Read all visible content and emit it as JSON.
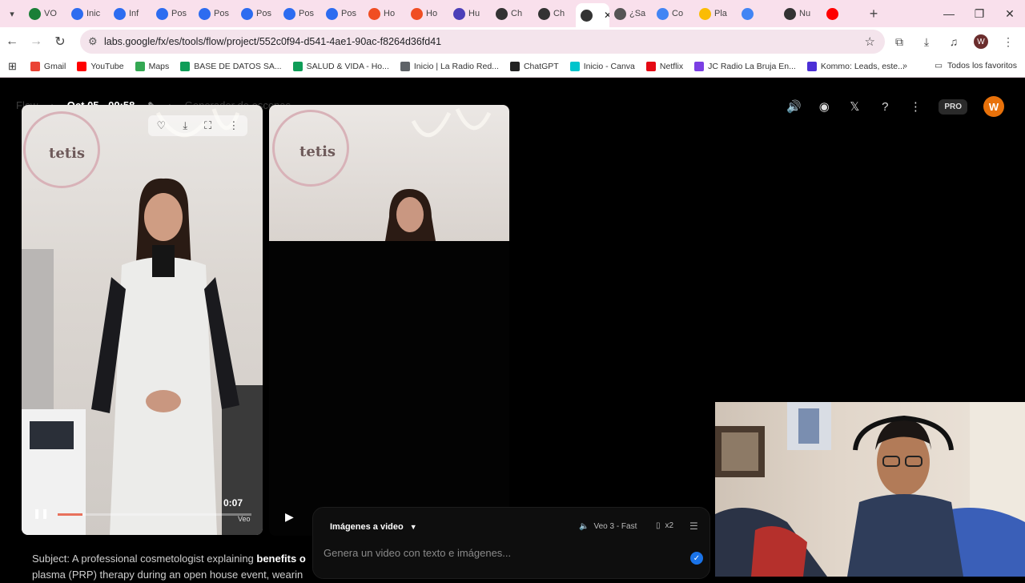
{
  "browser": {
    "tabs": [
      {
        "label": "VO",
        "icon": "github-icon",
        "color": "#1a7f37"
      },
      {
        "label": "Inic",
        "icon": "zoom-icon",
        "color": "#2d6cf0"
      },
      {
        "label": "Inf",
        "icon": "zoom-icon",
        "color": "#2d6cf0"
      },
      {
        "label": "Pos",
        "icon": "zoom-icon",
        "color": "#2d6cf0"
      },
      {
        "label": "Pos",
        "icon": "zoom-icon",
        "color": "#2d6cf0"
      },
      {
        "label": "Pos",
        "icon": "zoom-icon",
        "color": "#2d6cf0"
      },
      {
        "label": "Pos",
        "icon": "zoom-icon",
        "color": "#2d6cf0"
      },
      {
        "label": "Pos",
        "icon": "zoom-icon",
        "color": "#2d6cf0"
      },
      {
        "label": "Ho",
        "icon": "hotmart-icon",
        "color": "#f04e23"
      },
      {
        "label": "Ho",
        "icon": "hotmart-icon",
        "color": "#f04e23"
      },
      {
        "label": "Hu",
        "icon": "robot-icon",
        "color": "#4c3fb8"
      },
      {
        "label": "Ch",
        "icon": "chatgpt-icon",
        "color": "#333333"
      },
      {
        "label": "Ch",
        "icon": "chatgpt-icon",
        "color": "#333333"
      },
      {
        "label": "",
        "icon": "flow-icon",
        "color": "#333333",
        "active": true
      },
      {
        "label": "¿Sa",
        "icon": "globe-icon",
        "color": "#555555"
      },
      {
        "label": "Co",
        "icon": "google-icon",
        "color": "#4285f4"
      },
      {
        "label": "Pla",
        "icon": "google-icon",
        "color": "#fbbc04"
      },
      {
        "label": "",
        "icon": "docs-icon",
        "color": "#4285f4"
      },
      {
        "label": "Nu",
        "icon": "chatgpt-icon",
        "color": "#333333"
      },
      {
        "label": "",
        "icon": "youtube-icon",
        "color": "#ff0000"
      }
    ],
    "url": "labs.google/fx/es/tools/flow/project/552c0f94-d541-4ae1-90ac-f8264d36fd41",
    "profile_initial": "W",
    "bookmarks": [
      {
        "label": "Gmail",
        "color": "#ea4335"
      },
      {
        "label": "YouTube",
        "color": "#ff0000"
      },
      {
        "label": "Maps",
        "color": "#34a853"
      },
      {
        "label": "BASE DE DATOS SA...",
        "color": "#0f9d58"
      },
      {
        "label": "SALUD & VIDA - Ho...",
        "color": "#0f9d58"
      },
      {
        "label": "Inicio | La Radio Red...",
        "color": "#5f6368"
      },
      {
        "label": "ChatGPT",
        "color": "#222222"
      },
      {
        "label": "Inicio - Canva",
        "color": "#00c4cc"
      },
      {
        "label": "Netflix",
        "color": "#e50914"
      },
      {
        "label": "JC Radio La Bruja En...",
        "color": "#7b3fe4"
      },
      {
        "label": "Kommo: Leads, este...",
        "color": "#4b2fd6"
      }
    ],
    "all_bookmarks": "Todos los favoritos"
  },
  "page": {
    "breadcrumb_root": "Flow",
    "project_title": "Oct 05 - 00:58",
    "breadcrumb_current": "Generador de escenas",
    "pro_badge": "PRO",
    "avatar_initial": "W",
    "accent": "#e8710a"
  },
  "video1": {
    "time": "0:07",
    "watermark": "Veo",
    "logo": "tetis",
    "progress": 0.13
  },
  "video2": {
    "logo": "tetis"
  },
  "prompt": {
    "mode": "Imágenes a video",
    "model": "Veo 3 - Fast",
    "count": "x2",
    "placeholder": "Genera un video con texto e imágenes..."
  },
  "subject": {
    "line1_prefix": "Subject: A professional cosmetologist explaining ",
    "line1_bold": "benefits o",
    "line2": "plasma (PRP) therapy during an open house event, wearin"
  }
}
